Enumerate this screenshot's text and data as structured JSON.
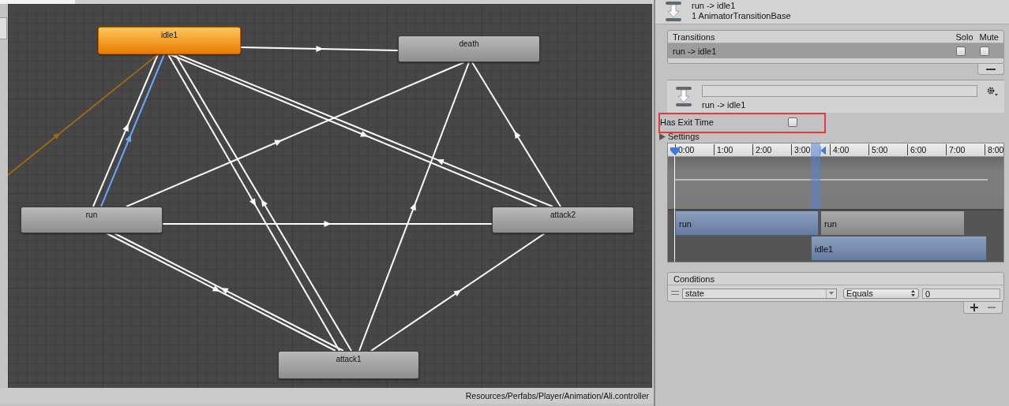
{
  "graph": {
    "states": [
      {
        "name": "idle1",
        "selected": true
      },
      {
        "name": "death",
        "selected": false
      },
      {
        "name": "run",
        "selected": false
      },
      {
        "name": "attack2",
        "selected": false
      },
      {
        "name": "attack1",
        "selected": false
      }
    ],
    "path": "Resources/Perfabs/Player/Animation/Ali.controller"
  },
  "inspector": {
    "header": {
      "title": "run -> idle1",
      "subtitle": "1 AnimatorTransitionBase"
    },
    "transitions": {
      "title": "Transitions",
      "columns": [
        "Solo",
        "Mute"
      ],
      "rows": [
        {
          "name": "run -> idle1",
          "selected": true,
          "solo": false,
          "mute": false
        }
      ]
    },
    "transition": {
      "name": "run -> idle1"
    },
    "has_exit_time": {
      "label": "Has Exit Time",
      "checked": false
    },
    "settings": {
      "label": "Settings",
      "expanded": false
    },
    "timeline": {
      "ticks": [
        "0:00",
        "1:00",
        "2:00",
        "3:00",
        "4:00",
        "5:00",
        "6:00",
        "7:00",
        "8:00"
      ],
      "clips": [
        {
          "label": "run",
          "kind": "source"
        },
        {
          "label": "run",
          "kind": "next"
        },
        {
          "label": "idle1",
          "kind": "target"
        }
      ]
    },
    "conditions": {
      "title": "Conditions",
      "rows": [
        {
          "parameter": "state",
          "operator": "Equals",
          "value": "0"
        }
      ]
    }
  }
}
